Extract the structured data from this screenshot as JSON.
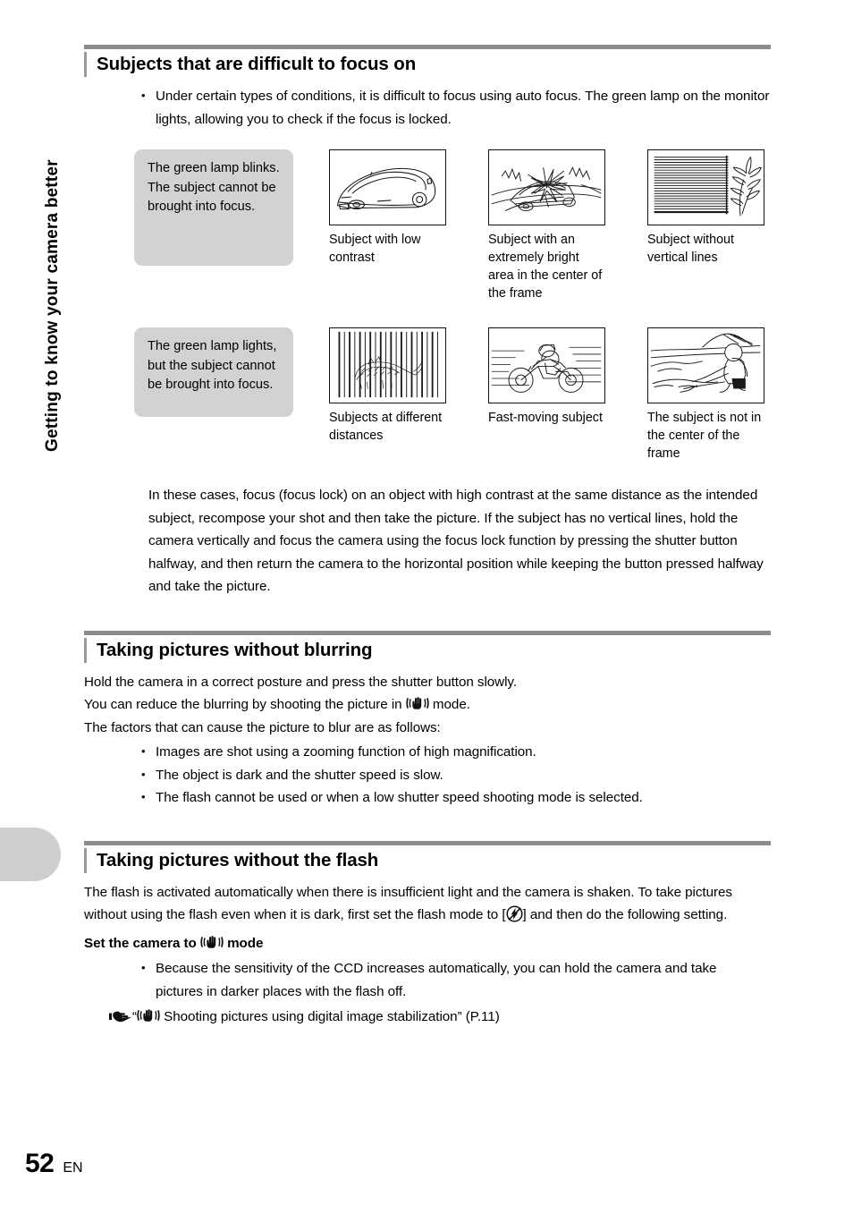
{
  "page": {
    "number": "52",
    "language": "EN",
    "chapter_tab": "Getting to know your camera better"
  },
  "sections": [
    {
      "title": "Subjects that are difficult to focus on",
      "intro_bullet": "Under certain types of conditions, it is difficult to focus using auto focus. The green lamp on the monitor lights, allowing you to check if the focus is locked.",
      "rows": [
        {
          "callout": "The green lamp blinks.\nThe subject cannot be brought into focus.",
          "figures": [
            {
              "icon": "car-low-contrast-image",
              "caption": "Subject with low contrast"
            },
            {
              "icon": "car-bright-glare-image",
              "caption": "Subject with an extremely bright area in the center of the frame"
            },
            {
              "icon": "blinds-no-vertical-lines-image",
              "caption": "Subject without vertical lines"
            }
          ]
        },
        {
          "callout": "The green lamp lights, but the subject cannot be brought into focus.",
          "figures": [
            {
              "icon": "tiger-behind-bars-image",
              "caption": "Subjects at different distances"
            },
            {
              "icon": "motorcycle-fast-moving-image",
              "caption": "Fast-moving subject"
            },
            {
              "icon": "person-off-center-image",
              "caption": "The subject is not in the center of the frame"
            }
          ]
        }
      ],
      "closing_paragraph": "In these cases, focus (focus lock) on an object with high contrast at the same distance as the intended subject, recompose your shot and then take the picture. If the subject has no vertical lines, hold the camera vertically and focus the camera using the focus lock function by pressing the shutter button halfway, and then return the camera to the horizontal position while keeping the button pressed halfway and take the picture."
    },
    {
      "title": "Taking pictures without blurring",
      "lines": [
        "Hold the camera in a correct posture and press the shutter button slowly.",
        "The factors that can cause the picture to blur are as follows:"
      ],
      "line_with_icon": {
        "before": "You can reduce the blurring by shooting the picture in ",
        "icon": "image-stabilization-icon",
        "after": " mode."
      },
      "bullets": [
        "Images are shot using a zooming function of high magnification.",
        "The object is dark and the shutter speed is slow.",
        "The flash cannot be used or when a low shutter speed shooting mode is selected."
      ]
    },
    {
      "title": "Taking pictures without the flash",
      "paragraph": {
        "before": "The flash is activated automatically when there is insufficient light and the camera is shaken. To take pictures without using the flash even when it is dark, first set the flash mode to [",
        "icon": "flash-off-icon",
        "after": "] and then do the following setting."
      },
      "subheading": {
        "before": "Set the camera to ",
        "icon": "image-stabilization-icon",
        "after": " mode"
      },
      "bullets": [
        "Because the sensitivity of the CCD increases automatically, you can hold the camera and take pictures in darker places with the flash off."
      ],
      "reference": {
        "pointer_icon": "pointing-hand-icon",
        "open_quote": "“",
        "icon": "image-stabilization-icon",
        "text": " Shooting pictures using digital image stabilization” (P.11)"
      }
    }
  ],
  "colors": {
    "rule": "#8c8c8c",
    "callout_bg": "#d2d2d2",
    "tab_bg": "#cfcfcf"
  }
}
